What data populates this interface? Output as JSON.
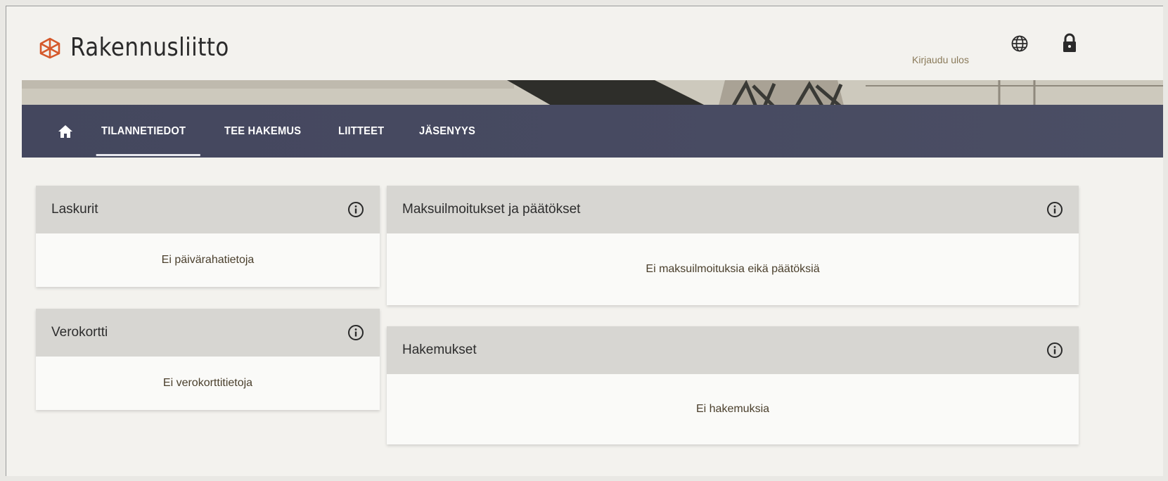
{
  "brand": {
    "name": "Rakennusliitto",
    "color": "#d5582a"
  },
  "header": {
    "logout_label": "Kirjaudu ulos",
    "language_icon": "globe-icon",
    "lock_icon": "lock-icon"
  },
  "nav": {
    "home_icon": "home-icon",
    "items": [
      {
        "label": "TILANNETIEDOT",
        "active": true
      },
      {
        "label": "TEE HAKEMUS",
        "active": false
      },
      {
        "label": "LIITTEET",
        "active": false
      },
      {
        "label": "JÄSENYYS",
        "active": false
      }
    ]
  },
  "cards": {
    "laskurit": {
      "title": "Laskurit",
      "empty_text": "Ei päivärahatietoja"
    },
    "verokortti": {
      "title": "Verokortti",
      "empty_text": "Ei verokorttitietoja"
    },
    "maksuilmoitukset": {
      "title": "Maksuilmoitukset ja päätökset",
      "empty_text": "Ei maksuilmoituksia eikä päätöksiä"
    },
    "hakemukset": {
      "title": "Hakemukset",
      "empty_text": "Ei hakemuksia"
    }
  }
}
